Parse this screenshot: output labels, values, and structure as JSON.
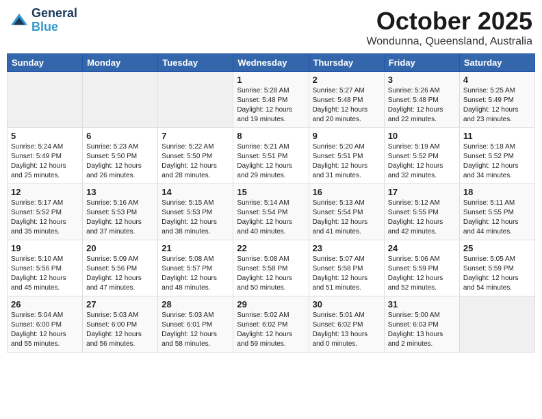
{
  "header": {
    "logo_line1": "General",
    "logo_line2": "Blue",
    "month": "October 2025",
    "location": "Wondunna, Queensland, Australia"
  },
  "days_of_week": [
    "Sunday",
    "Monday",
    "Tuesday",
    "Wednesday",
    "Thursday",
    "Friday",
    "Saturday"
  ],
  "weeks": [
    [
      {
        "day": "",
        "info": ""
      },
      {
        "day": "",
        "info": ""
      },
      {
        "day": "",
        "info": ""
      },
      {
        "day": "1",
        "info": "Sunrise: 5:28 AM\nSunset: 5:48 PM\nDaylight: 12 hours\nand 19 minutes."
      },
      {
        "day": "2",
        "info": "Sunrise: 5:27 AM\nSunset: 5:48 PM\nDaylight: 12 hours\nand 20 minutes."
      },
      {
        "day": "3",
        "info": "Sunrise: 5:26 AM\nSunset: 5:48 PM\nDaylight: 12 hours\nand 22 minutes."
      },
      {
        "day": "4",
        "info": "Sunrise: 5:25 AM\nSunset: 5:49 PM\nDaylight: 12 hours\nand 23 minutes."
      }
    ],
    [
      {
        "day": "5",
        "info": "Sunrise: 5:24 AM\nSunset: 5:49 PM\nDaylight: 12 hours\nand 25 minutes."
      },
      {
        "day": "6",
        "info": "Sunrise: 5:23 AM\nSunset: 5:50 PM\nDaylight: 12 hours\nand 26 minutes."
      },
      {
        "day": "7",
        "info": "Sunrise: 5:22 AM\nSunset: 5:50 PM\nDaylight: 12 hours\nand 28 minutes."
      },
      {
        "day": "8",
        "info": "Sunrise: 5:21 AM\nSunset: 5:51 PM\nDaylight: 12 hours\nand 29 minutes."
      },
      {
        "day": "9",
        "info": "Sunrise: 5:20 AM\nSunset: 5:51 PM\nDaylight: 12 hours\nand 31 minutes."
      },
      {
        "day": "10",
        "info": "Sunrise: 5:19 AM\nSunset: 5:52 PM\nDaylight: 12 hours\nand 32 minutes."
      },
      {
        "day": "11",
        "info": "Sunrise: 5:18 AM\nSunset: 5:52 PM\nDaylight: 12 hours\nand 34 minutes."
      }
    ],
    [
      {
        "day": "12",
        "info": "Sunrise: 5:17 AM\nSunset: 5:52 PM\nDaylight: 12 hours\nand 35 minutes."
      },
      {
        "day": "13",
        "info": "Sunrise: 5:16 AM\nSunset: 5:53 PM\nDaylight: 12 hours\nand 37 minutes."
      },
      {
        "day": "14",
        "info": "Sunrise: 5:15 AM\nSunset: 5:53 PM\nDaylight: 12 hours\nand 38 minutes."
      },
      {
        "day": "15",
        "info": "Sunrise: 5:14 AM\nSunset: 5:54 PM\nDaylight: 12 hours\nand 40 minutes."
      },
      {
        "day": "16",
        "info": "Sunrise: 5:13 AM\nSunset: 5:54 PM\nDaylight: 12 hours\nand 41 minutes."
      },
      {
        "day": "17",
        "info": "Sunrise: 5:12 AM\nSunset: 5:55 PM\nDaylight: 12 hours\nand 42 minutes."
      },
      {
        "day": "18",
        "info": "Sunrise: 5:11 AM\nSunset: 5:55 PM\nDaylight: 12 hours\nand 44 minutes."
      }
    ],
    [
      {
        "day": "19",
        "info": "Sunrise: 5:10 AM\nSunset: 5:56 PM\nDaylight: 12 hours\nand 45 minutes."
      },
      {
        "day": "20",
        "info": "Sunrise: 5:09 AM\nSunset: 5:56 PM\nDaylight: 12 hours\nand 47 minutes."
      },
      {
        "day": "21",
        "info": "Sunrise: 5:08 AM\nSunset: 5:57 PM\nDaylight: 12 hours\nand 48 minutes."
      },
      {
        "day": "22",
        "info": "Sunrise: 5:08 AM\nSunset: 5:58 PM\nDaylight: 12 hours\nand 50 minutes."
      },
      {
        "day": "23",
        "info": "Sunrise: 5:07 AM\nSunset: 5:58 PM\nDaylight: 12 hours\nand 51 minutes."
      },
      {
        "day": "24",
        "info": "Sunrise: 5:06 AM\nSunset: 5:59 PM\nDaylight: 12 hours\nand 52 minutes."
      },
      {
        "day": "25",
        "info": "Sunrise: 5:05 AM\nSunset: 5:59 PM\nDaylight: 12 hours\nand 54 minutes."
      }
    ],
    [
      {
        "day": "26",
        "info": "Sunrise: 5:04 AM\nSunset: 6:00 PM\nDaylight: 12 hours\nand 55 minutes."
      },
      {
        "day": "27",
        "info": "Sunrise: 5:03 AM\nSunset: 6:00 PM\nDaylight: 12 hours\nand 56 minutes."
      },
      {
        "day": "28",
        "info": "Sunrise: 5:03 AM\nSunset: 6:01 PM\nDaylight: 12 hours\nand 58 minutes."
      },
      {
        "day": "29",
        "info": "Sunrise: 5:02 AM\nSunset: 6:02 PM\nDaylight: 12 hours\nand 59 minutes."
      },
      {
        "day": "30",
        "info": "Sunrise: 5:01 AM\nSunset: 6:02 PM\nDaylight: 13 hours\nand 0 minutes."
      },
      {
        "day": "31",
        "info": "Sunrise: 5:00 AM\nSunset: 6:03 PM\nDaylight: 13 hours\nand 2 minutes."
      },
      {
        "day": "",
        "info": ""
      }
    ]
  ]
}
